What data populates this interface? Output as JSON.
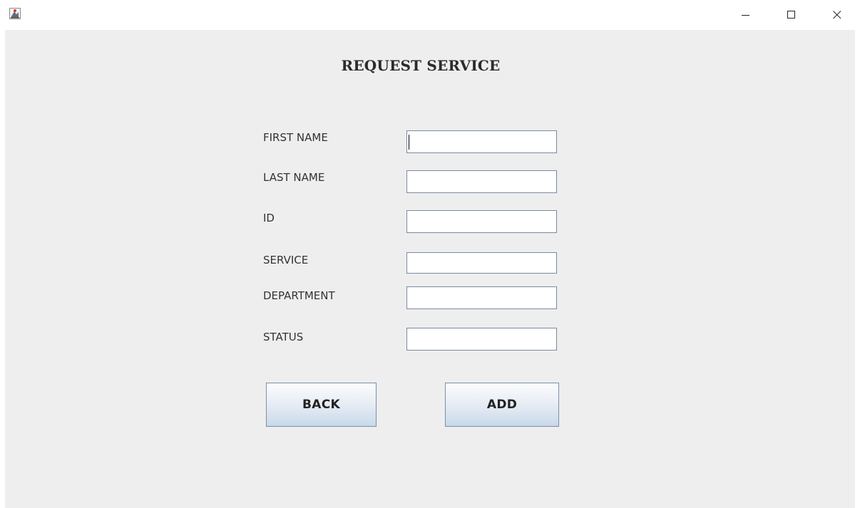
{
  "window": {
    "controls": {
      "minimize_icon": "minimize-icon",
      "maximize_icon": "maximize-icon",
      "close_icon": "close-icon"
    }
  },
  "form": {
    "title": "REQUEST SERVICE",
    "fields": {
      "first_name": {
        "label": "FIRST NAME",
        "value": ""
      },
      "last_name": {
        "label": "LAST NAME",
        "value": ""
      },
      "id": {
        "label": "ID",
        "value": ""
      },
      "service": {
        "label": "SERVICE",
        "value": ""
      },
      "department": {
        "label": "DEPARTMENT",
        "value": ""
      },
      "status": {
        "label": "STATUS",
        "value": ""
      }
    },
    "buttons": {
      "back_label": "BACK",
      "add_label": "ADD"
    }
  },
  "colors": {
    "content_background": "#eeeeee",
    "field_border": "#7a8a9f",
    "button_gradient_top": "#fbfcfe",
    "button_gradient_bottom": "#c9d9ea"
  }
}
